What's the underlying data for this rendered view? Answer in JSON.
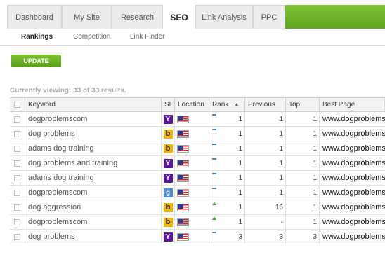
{
  "tabs": [
    {
      "label": "Dashboard",
      "active": false
    },
    {
      "label": "My Site",
      "active": false
    },
    {
      "label": "Research",
      "active": false
    },
    {
      "label": "SEO",
      "active": true
    },
    {
      "label": "Link Analysis",
      "active": false
    },
    {
      "label": "PPC",
      "active": false
    }
  ],
  "subtabs": [
    {
      "label": "Rankings",
      "active": true
    },
    {
      "label": "Competition",
      "active": false
    },
    {
      "label": "Link Finder",
      "active": false
    }
  ],
  "update_label": "UPDATE",
  "viewing_text": "Currently viewing: 33 of 33 results.",
  "table": {
    "headers": {
      "keyword": "Keyword",
      "se": "SE",
      "location": "Location",
      "rank": "Rank",
      "previous": "Previous",
      "top": "Top",
      "best_page": "Best Page"
    },
    "rows": [
      {
        "keyword": "dogproblemscom",
        "se": "Y",
        "se_engine": "yahoo",
        "rank": "1",
        "previous": "1",
        "top": "1",
        "trend": "flat",
        "best_page": "www.dogproblems.com"
      },
      {
        "keyword": "dog problems",
        "se": "b",
        "se_engine": "bing",
        "rank": "1",
        "previous": "1",
        "top": "1",
        "trend": "flat",
        "best_page": "www.dogproblems.com"
      },
      {
        "keyword": "adams dog training",
        "se": "b",
        "se_engine": "bing",
        "rank": "1",
        "previous": "1",
        "top": "1",
        "trend": "flat",
        "best_page": "www.dogproblems.com"
      },
      {
        "keyword": "dog problems and training",
        "se": "Y",
        "se_engine": "yahoo",
        "rank": "1",
        "previous": "1",
        "top": "1",
        "trend": "flat",
        "best_page": "www.dogproblems.com"
      },
      {
        "keyword": "adams dog training",
        "se": "Y",
        "se_engine": "yahoo",
        "rank": "1",
        "previous": "1",
        "top": "1",
        "trend": "flat",
        "best_page": "www.dogproblems.com"
      },
      {
        "keyword": "dogproblemscom",
        "se": "g",
        "se_engine": "google",
        "rank": "1",
        "previous": "1",
        "top": "1",
        "trend": "flat",
        "best_page": "www.dogproblems.com"
      },
      {
        "keyword": "dog aggression",
        "se": "b",
        "se_engine": "bing",
        "rank": "1",
        "previous": "16",
        "top": "1",
        "trend": "up",
        "best_page": "www.dogproblems.com"
      },
      {
        "keyword": "dogproblemscom",
        "se": "b",
        "se_engine": "bing",
        "rank": "1",
        "previous": "-",
        "top": "1",
        "trend": "up",
        "best_page": "www.dogproblems.com"
      },
      {
        "keyword": "dog problems",
        "se": "Y",
        "se_engine": "yahoo",
        "rank": "3",
        "previous": "3",
        "top": "3",
        "trend": "flat",
        "best_page": "www.dogproblems.com"
      }
    ]
  },
  "colors": {
    "accent_green": "#6cb52a",
    "yahoo": "#5b16a0",
    "bing": "#f2b400",
    "google": "#4a8ae8",
    "trend_up": "#4caf24",
    "trend_flat": "#3b8fd6"
  }
}
